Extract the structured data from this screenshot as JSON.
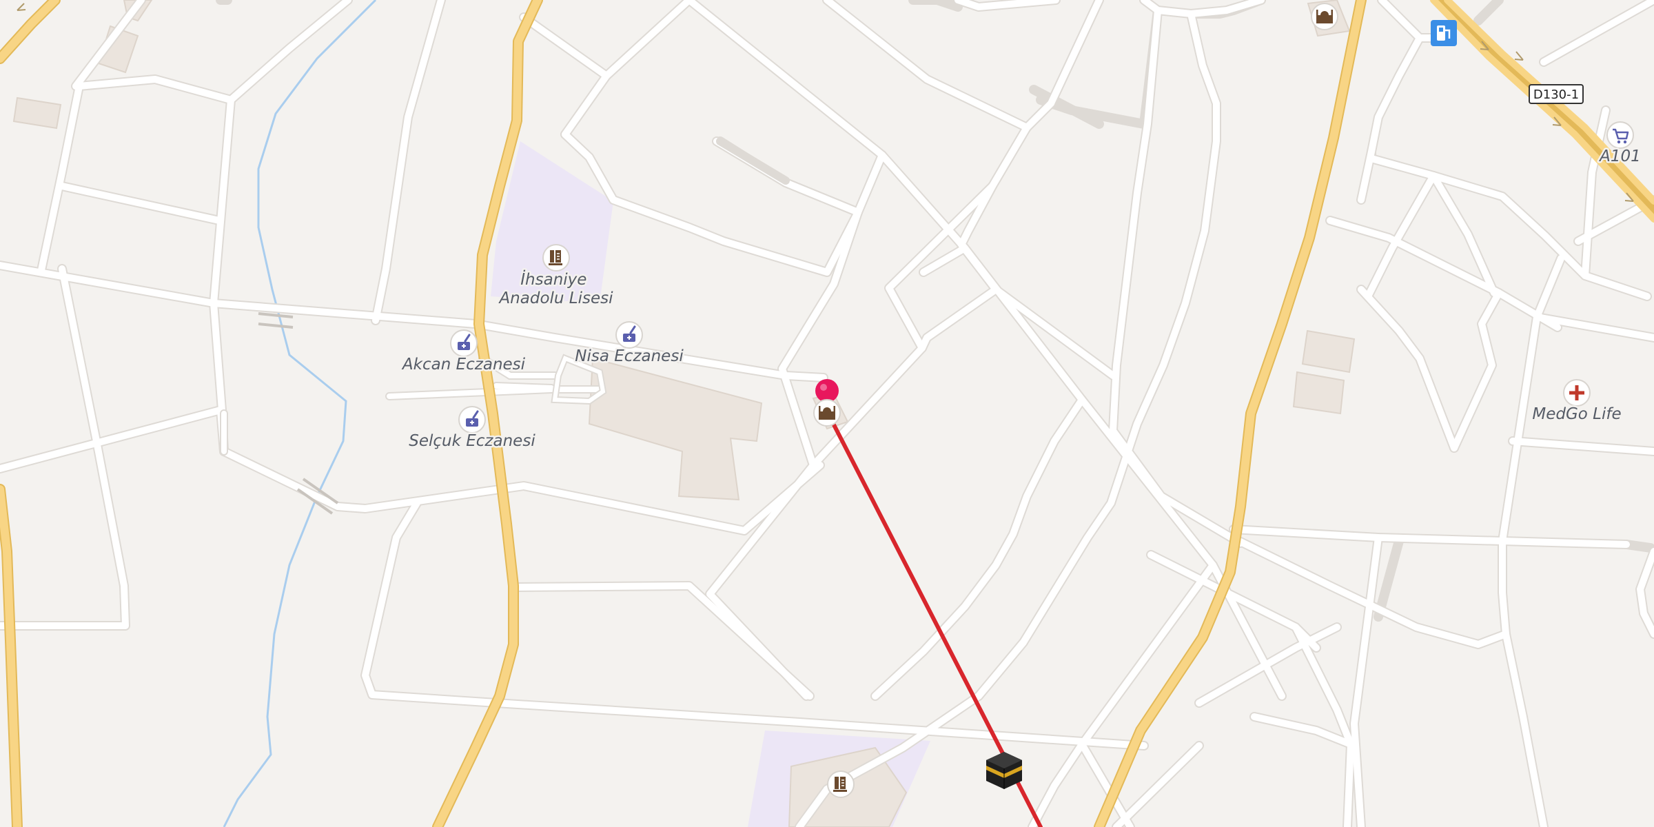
{
  "map": {
    "road_ref": "D130-1",
    "pois": [
      {
        "name": "İhsaniye Anadolu Lisesi",
        "lines": [
          "İhsaniye",
          "Anadolu Lisesi"
        ],
        "icon": "school-icon"
      },
      {
        "name": "Nisa Eczanesi",
        "icon": "pharmacy-icon"
      },
      {
        "name": "Akcan Eczanesi",
        "icon": "pharmacy-icon"
      },
      {
        "name": "Selçuk Eczanesi",
        "icon": "pharmacy-icon"
      },
      {
        "name": "MedGo Life",
        "icon": "medical-cross-icon"
      },
      {
        "name": "A101",
        "icon": "shopping-cart-icon"
      }
    ],
    "unlabeled_icons": [
      "mosque-icon",
      "mosque-icon",
      "school-icon",
      "fuel-station-icon",
      "kaaba-qibla-icon",
      "location-pin-icon"
    ],
    "colors": {
      "background": "#f4f2ef",
      "road": "#ffffff",
      "major_road": "#f8d585",
      "school_area": "#ece6f6",
      "stream": "#a9cdee",
      "qibla_line": "#d8262c",
      "pin": "#e8175d",
      "pharmacy_icon": "#5a5fae",
      "medical_icon": "#c0392b",
      "fuel_badge": "#3a8ee6"
    }
  }
}
